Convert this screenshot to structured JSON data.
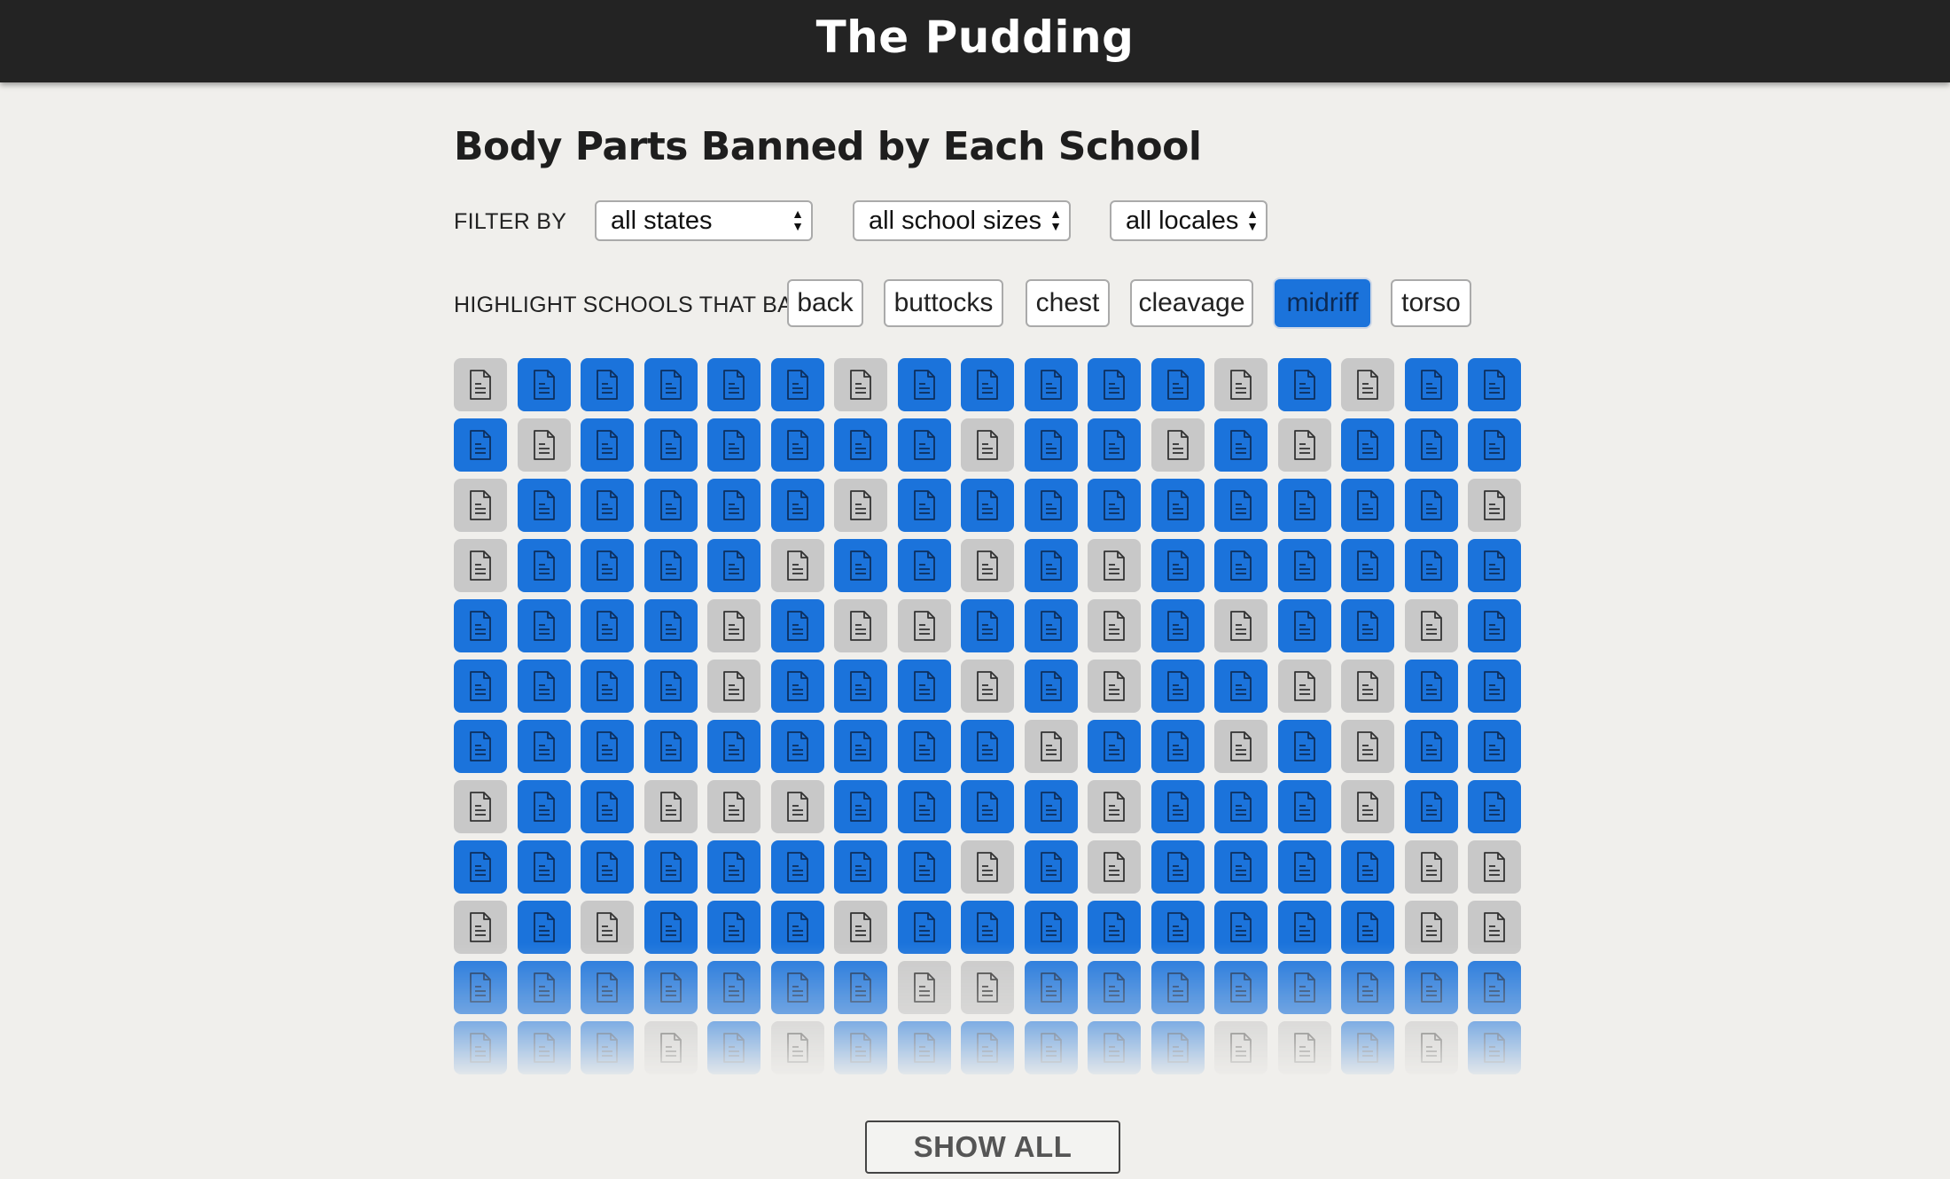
{
  "header": {
    "logo": "The Pudding"
  },
  "title": "Body Parts Banned by Each School",
  "filters": {
    "label": "FILTER BY",
    "state": "all states",
    "size": "all school sizes",
    "locale": "all locales"
  },
  "highlight": {
    "label": "HIGHLIGHT SCHOOLS THAT BAN",
    "chips": [
      "back",
      "buttocks",
      "chest",
      "cleavage",
      "midriff",
      "torso"
    ],
    "active": "midriff"
  },
  "grid": {
    "icon": "document-icon",
    "highlight_color": "#1b73db",
    "other_color": "#c8c8c8",
    "rows": [
      "01111101111101011",
      "10111111011010111",
      "01111101111111110",
      "01111011010111111",
      "11110100110101101",
      "11110111010110011",
      "11111111101101011",
      "01100011110111011",
      "11111111010111100",
      "01011101111111100",
      "11111110011111111",
      "11101011111100101"
    ]
  },
  "show_all": "SHOW ALL"
}
